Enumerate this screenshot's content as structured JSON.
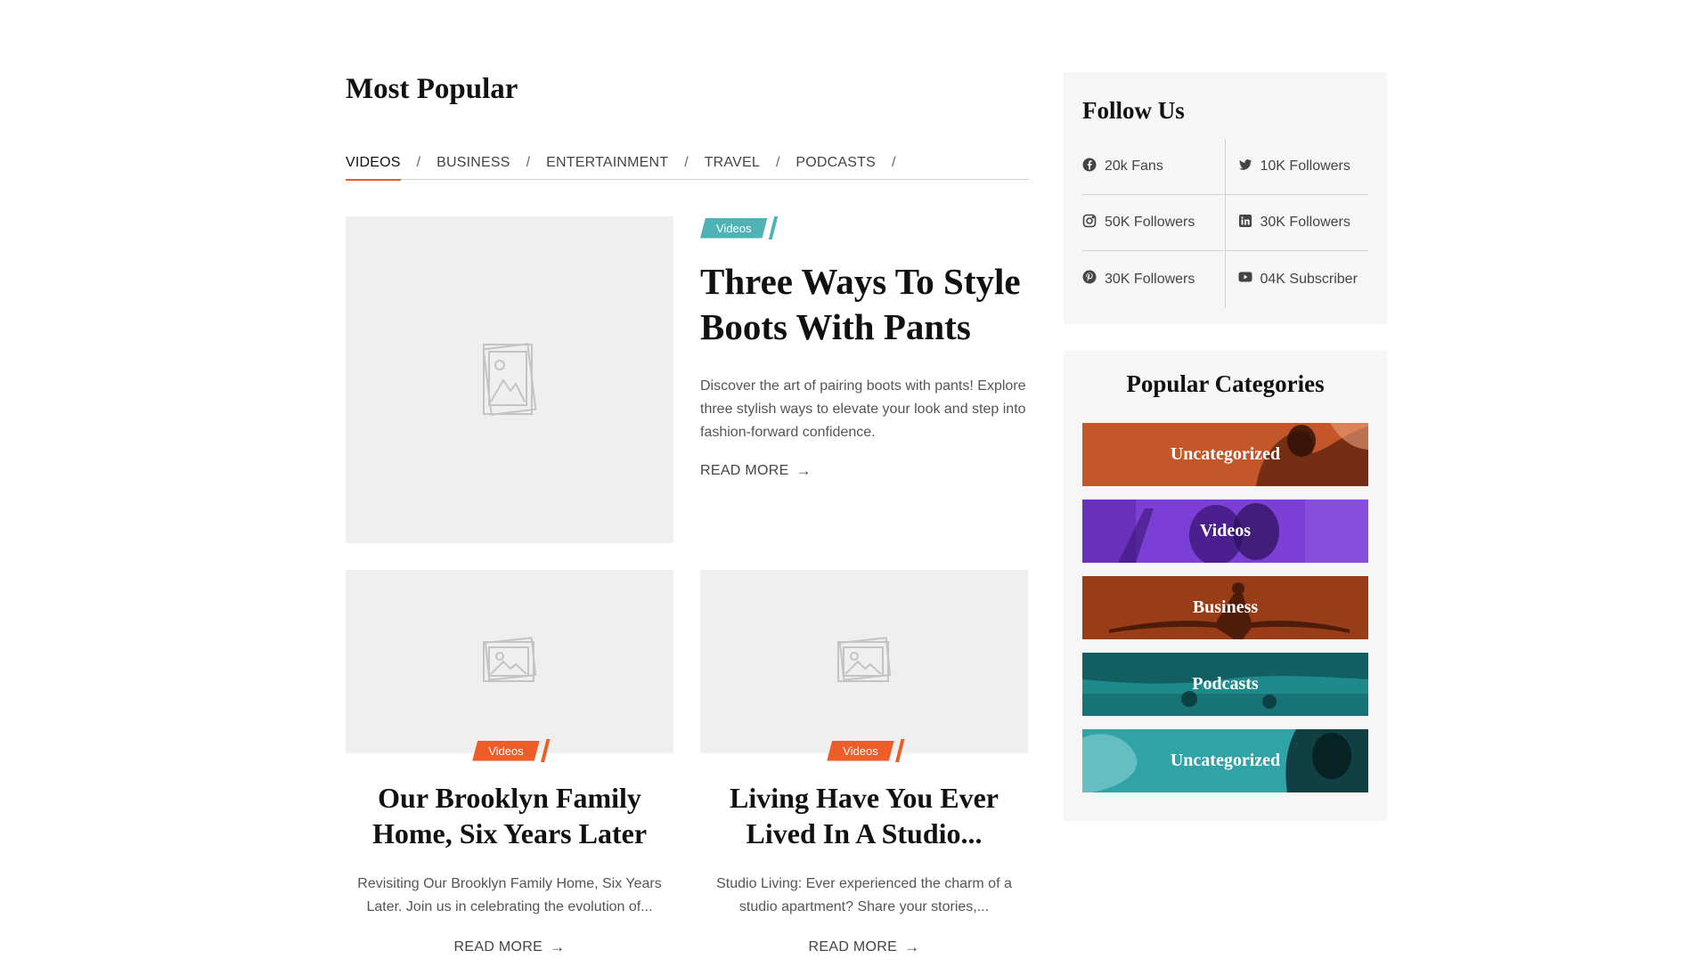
{
  "section": {
    "title": "Most Popular"
  },
  "tabs": [
    {
      "label": "VIDEOS",
      "active": true
    },
    {
      "label": "BUSINESS",
      "active": false
    },
    {
      "label": "ENTERTAINMENT",
      "active": false
    },
    {
      "label": "TRAVEL",
      "active": false
    },
    {
      "label": "PODCASTS",
      "active": false
    }
  ],
  "tab_separator": "/",
  "featured": {
    "badge": "Videos",
    "badge_color": "#4fb3b5",
    "title": "Three Ways To Style Boots With Pants",
    "excerpt": "Discover the art of pairing boots with pants! Explore three stylish ways to elevate your look and step into fashion-forward confidence.",
    "read_more": "READ MORE",
    "image_icon": "image-placeholder-icon"
  },
  "cards": [
    {
      "badge": "Videos",
      "badge_color": "#ee5c28",
      "title": "Our Brooklyn Family Home, Six Years Later",
      "excerpt": "Revisiting Our Brooklyn Family Home, Six Years Later. Join us in celebrating the evolution of...",
      "read_more": "READ MORE"
    },
    {
      "badge": "Videos",
      "badge_color": "#ee5c28",
      "title": "Living Have You Ever Lived In A Studio...",
      "excerpt": "Studio Living: Ever experienced the charm of a studio apartment? Share your stories,...",
      "read_more": "READ MORE"
    }
  ],
  "follow": {
    "title": "Follow Us",
    "items": [
      {
        "icon": "facebook-icon",
        "label": "20k Fans"
      },
      {
        "icon": "twitter-icon",
        "label": "10K Followers"
      },
      {
        "icon": "instagram-icon",
        "label": "50K Followers"
      },
      {
        "icon": "linkedin-icon",
        "label": "30K Followers"
      },
      {
        "icon": "pinterest-icon",
        "label": "30K Followers"
      },
      {
        "icon": "youtube-icon",
        "label": "04K Subscriber"
      }
    ]
  },
  "categories": {
    "title": "Popular Categories",
    "items": [
      {
        "label": "Uncategorized",
        "color": "#c4572a"
      },
      {
        "label": "Videos",
        "color": "#7b3fd6"
      },
      {
        "label": "Business",
        "color": "#a8461c"
      },
      {
        "label": "Podcasts",
        "color": "#1f8a8c"
      },
      {
        "label": "Uncategorized",
        "color": "#2fa3a6"
      }
    ]
  }
}
